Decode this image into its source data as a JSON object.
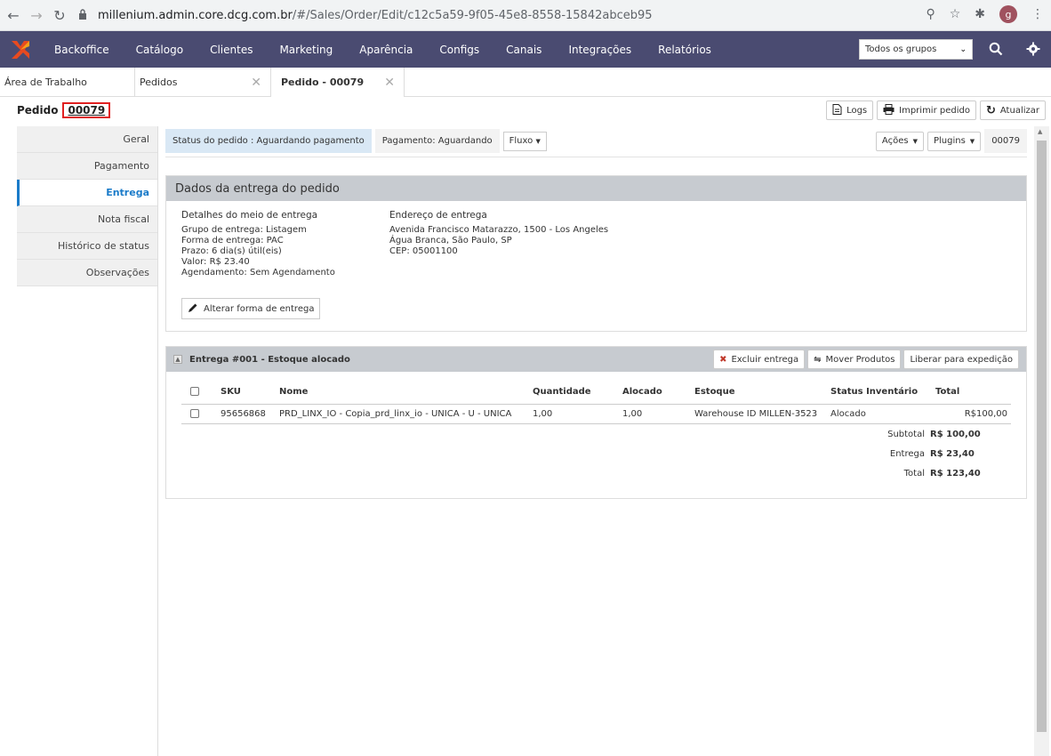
{
  "browser": {
    "url_host": "millenium.admin.core.dcg.com.br",
    "url_path": "/#/Sales/Order/Edit/c12c5a59-9f05-45e8-8558-15842abceb95",
    "profile_letter": "g"
  },
  "topnav": {
    "menu": [
      "Backoffice",
      "Catálogo",
      "Clientes",
      "Marketing",
      "Aparência",
      "Configs",
      "Canais",
      "Integrações",
      "Relatórios"
    ],
    "group_select": "Todos os grupos",
    "bg_color": "#4a4b71"
  },
  "tabs": [
    {
      "label": "Área de Trabalho",
      "closable": false
    },
    {
      "label": "Pedidos",
      "closable": true
    },
    {
      "label": "Pedido - 00079",
      "closable": true,
      "active": true
    }
  ],
  "page": {
    "title": "Pedido",
    "order_number": "00079",
    "buttons": {
      "logs": "Logs",
      "print": "Imprimir pedido",
      "refresh": "Atualizar"
    }
  },
  "sidebar": {
    "items": [
      "Geral",
      "Pagamento",
      "Entrega",
      "Nota fiscal",
      "Histórico de status",
      "Observações"
    ],
    "active": "Entrega"
  },
  "status_bar": {
    "order_status": "Status do pedido : Aguardando pagamento",
    "payment_status": "Pagamento: Aguardando",
    "fluxo": "Fluxo",
    "acoes": "Ações",
    "plugins": "Plugins",
    "number": "00079"
  },
  "delivery": {
    "panel_title": "Dados da entrega do pedido",
    "details_title": "Detalhes do meio de entrega",
    "details": [
      "Grupo de entrega: Listagem",
      "Forma de entrega: PAC",
      "Prazo: 6 dia(s) útil(eis)",
      "Valor: R$ 23.40",
      "Agendamento: Sem Agendamento"
    ],
    "address_title": "Endereço de entrega",
    "address": [
      "Avenida Francisco Matarazzo, 1500 - Los Angeles",
      "Água Branca, São Paulo, SP",
      "CEP: 05001100"
    ],
    "change_button": "Alterar forma de entrega"
  },
  "shipment": {
    "title": "Entrega #001 - Estoque alocado",
    "actions": {
      "delete": "Excluir entrega",
      "move": "Mover Produtos",
      "release": "Liberar para expedição"
    },
    "columns": [
      "SKU",
      "Nome",
      "Quantidade",
      "Alocado",
      "Estoque",
      "Status Inventário",
      "Total"
    ],
    "rows": [
      {
        "sku": "95656868",
        "name": "PRD_LINX_IO - Copia_prd_linx_io - UNICA - U - UNICA",
        "quantity": "1,00",
        "allocated": "1,00",
        "stock": "Warehouse ID MILLEN-3523",
        "inventory_status": "Alocado",
        "total": "R$100,00"
      }
    ],
    "totals": {
      "subtotal_label": "Subtotal",
      "subtotal": "R$ 100,00",
      "shipping_label": "Entrega",
      "shipping": "R$ 23,40",
      "total_label": "Total",
      "total": "R$ 123,40"
    }
  }
}
